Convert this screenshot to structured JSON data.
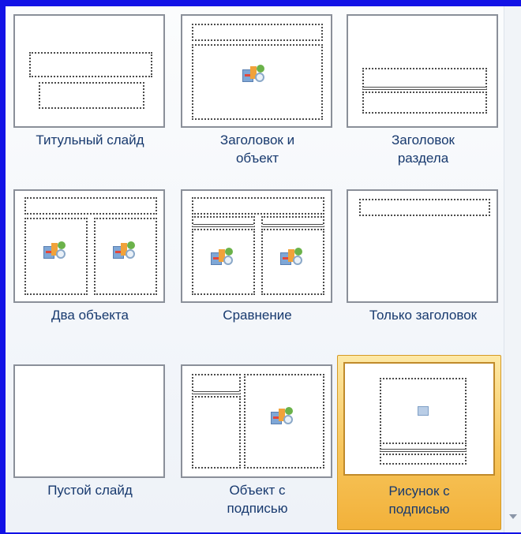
{
  "layouts": [
    {
      "name": "title-slide",
      "label": "Титульный слайд"
    },
    {
      "name": "title-and-content",
      "label": "Заголовок и\nобъект"
    },
    {
      "name": "section-header",
      "label": "Заголовок\nраздела"
    },
    {
      "name": "two-content",
      "label": "Два объекта"
    },
    {
      "name": "comparison",
      "label": "Сравнение"
    },
    {
      "name": "title-only",
      "label": "Только заголовок"
    },
    {
      "name": "blank",
      "label": "Пустой слайд"
    },
    {
      "name": "content-with-caption",
      "label": "Объект с\nподписью"
    },
    {
      "name": "picture-with-caption",
      "label": "Рисунок с\nподписью",
      "selected": true
    }
  ]
}
